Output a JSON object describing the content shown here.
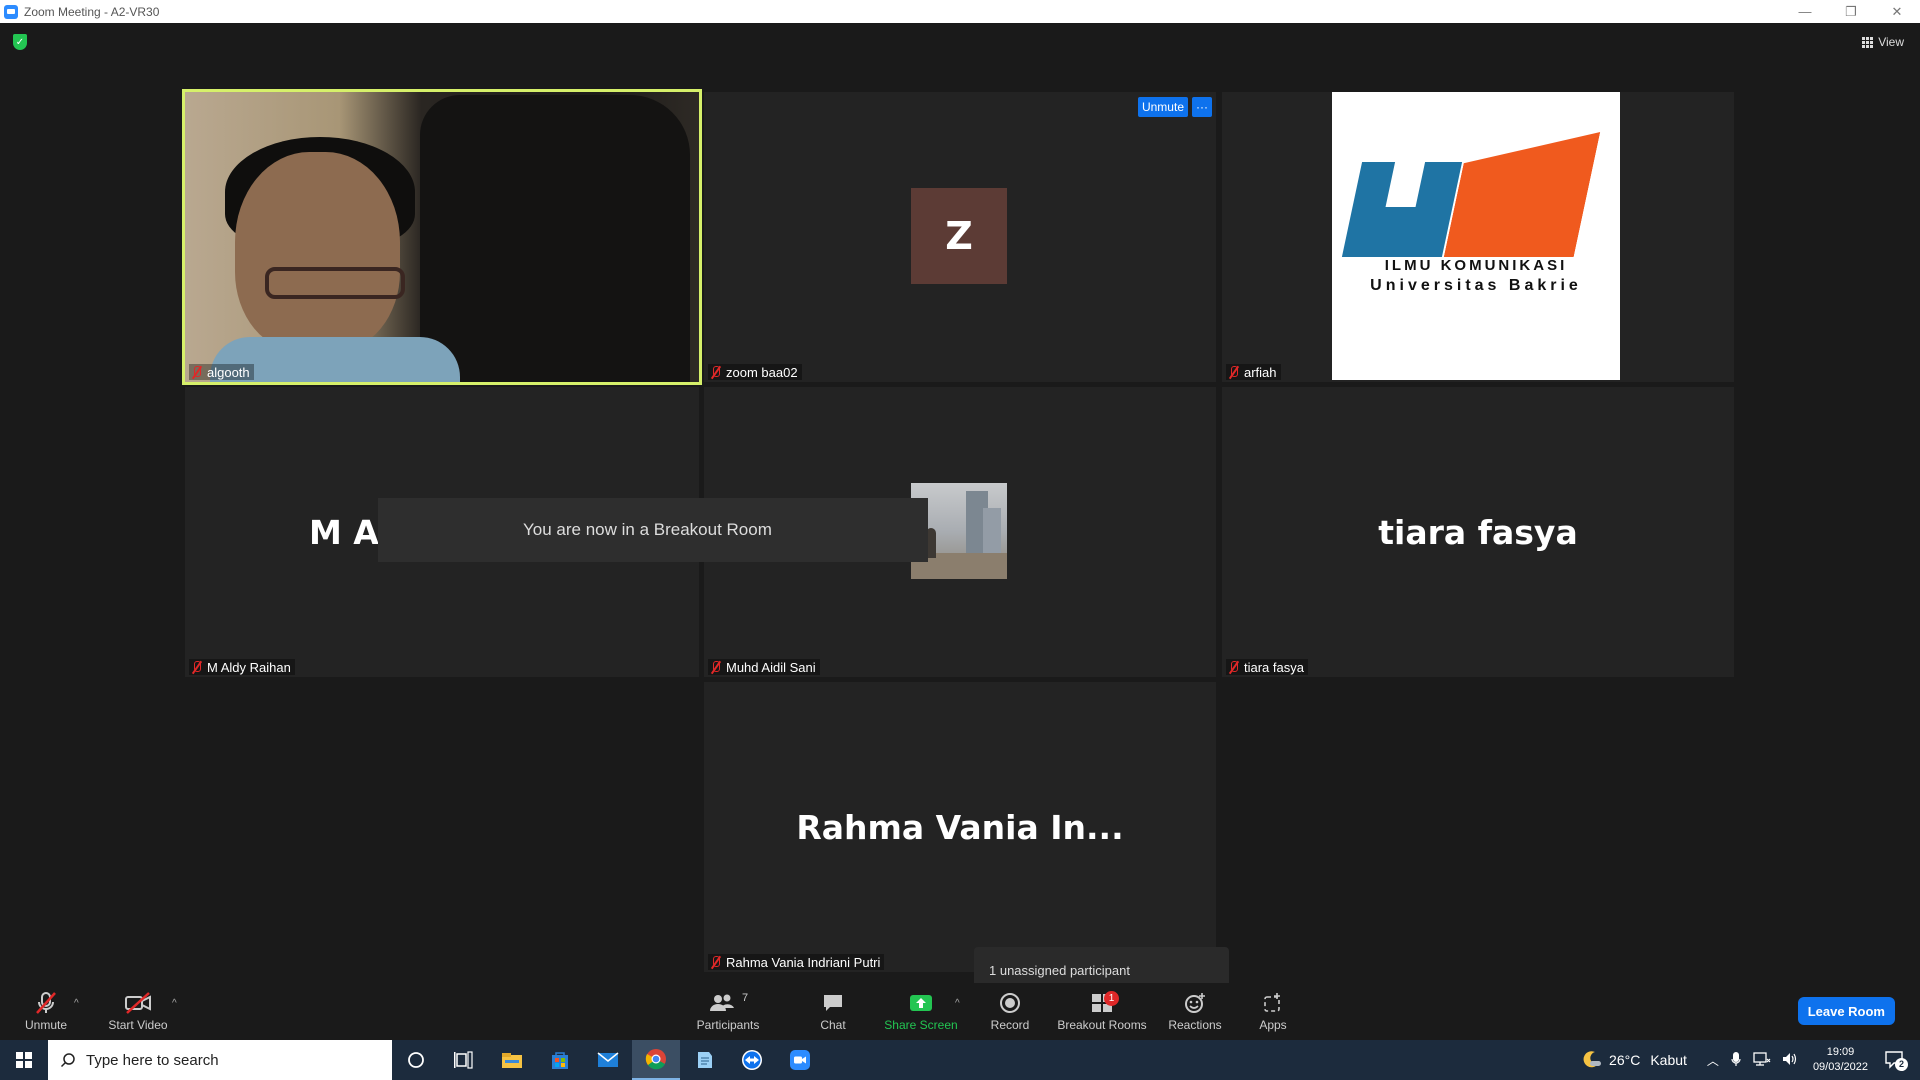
{
  "window": {
    "title": "Zoom Meeting - A2-VR30",
    "controls": [
      "—",
      "❐",
      "✕"
    ]
  },
  "top": {
    "view_label": "View"
  },
  "tiles": [
    {
      "name": "algooth",
      "display": "",
      "muted": true
    },
    {
      "name": "zoom baa02",
      "display": "Z",
      "muted": true,
      "unmute_label": "Unmute",
      "more_label": "···"
    },
    {
      "name": "arfiah",
      "display": "",
      "muted": true,
      "logo_line1": "ILMU KOMUNIKASI",
      "logo_line2": "Universitas Bakrie"
    },
    {
      "name": "M Aldy Raihan",
      "display": "M Aldy Raihan",
      "muted": true
    },
    {
      "name": "Muhd Aidil Sani",
      "display": "",
      "muted": true
    },
    {
      "name": "tiara fasya",
      "display": "tiara fasya",
      "muted": true
    },
    {
      "name": "Rahma Vania Indriani Putri",
      "display": "Rahma Vania In...",
      "muted": true
    }
  ],
  "toast": {
    "text": "You are now in a Breakout Room"
  },
  "tooltip": {
    "text": "1 unassigned participant"
  },
  "toolbar": {
    "unmute": "Unmute",
    "start_video": "Start Video",
    "participants": "Participants",
    "participants_count": "7",
    "chat": "Chat",
    "share_screen": "Share Screen",
    "record": "Record",
    "breakout_rooms": "Breakout Rooms",
    "breakout_badge": "1",
    "reactions": "Reactions",
    "apps": "Apps",
    "leave": "Leave Room"
  },
  "taskbar": {
    "search_placeholder": "Type here to search",
    "weather_temp": "26°C",
    "weather_desc": "Kabut",
    "time": "19:09",
    "date": "09/03/2022",
    "notification_count": "2"
  },
  "colors": {
    "accent": "#0e72ed",
    "active_speaker": "#d6f06a",
    "share_green": "#23c552",
    "muted_red": "#e02828"
  }
}
